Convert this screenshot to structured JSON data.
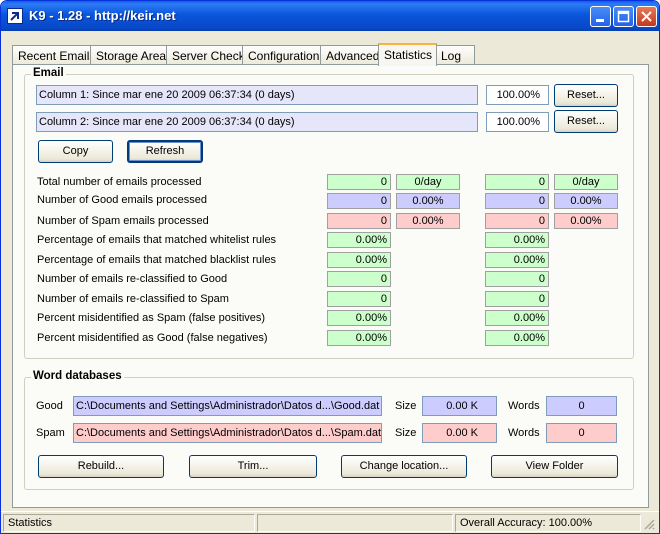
{
  "window": {
    "title": "K9 - 1.28 - http://keir.net"
  },
  "tabs": [
    "Recent Emails",
    "Storage Area",
    "Server Check",
    "Configuration",
    "Advanced",
    "Statistics",
    "Log"
  ],
  "email": {
    "group_title": "Email",
    "column1_text": "Column 1: Since mar ene 20 2009  06:37:34 (0 days)",
    "column1_accuracy": "100.00%",
    "column2_text": "Column 2: Since mar ene 20 2009  06:37:34 (0 days)",
    "column2_accuracy": "100.00%",
    "reset_label": "Reset...",
    "copy_label": "Copy",
    "refresh_label": "Refresh",
    "stats": [
      {
        "label": "Total number of emails processed",
        "c1": "0",
        "c1_rate": "0/day",
        "c2": "0",
        "c2_rate": "0/day",
        "tone": "green"
      },
      {
        "label": "Number of Good emails processed",
        "c1": "0",
        "c1_rate": "0.00%",
        "c2": "0",
        "c2_rate": "0.00%",
        "tone": "blue"
      },
      {
        "label": "Number of Spam emails processed",
        "c1": "0",
        "c1_rate": "0.00%",
        "c2": "0",
        "c2_rate": "0.00%",
        "tone": "red"
      },
      {
        "label": "Percentage of emails that matched whitelist rules",
        "c1": "0.00%",
        "c2": "0.00%",
        "tone": "green"
      },
      {
        "label": "Percentage of emails that matched blacklist rules",
        "c1": "0.00%",
        "c2": "0.00%",
        "tone": "green"
      },
      {
        "label": "Number of emails re-classified to Good",
        "c1": "0",
        "c2": "0",
        "tone": "green"
      },
      {
        "label": "Number of emails re-classified to Spam",
        "c1": "0",
        "c2": "0",
        "tone": "green"
      },
      {
        "label": "Percent misidentified as Spam (false positives)",
        "c1": "0.00%",
        "c2": "0.00%",
        "tone": "green"
      },
      {
        "label": "Percent misidentified as Good (false negatives)",
        "c1": "0.00%",
        "c2": "0.00%",
        "tone": "green"
      }
    ]
  },
  "word_databases": {
    "group_title": "Word databases",
    "good": {
      "label": "Good",
      "path": "C:\\Documents and Settings\\Administrador\\Datos d...\\Good.dat",
      "size_label": "Size",
      "size": "0.00 K",
      "words_label": "Words",
      "words": "0"
    },
    "spam": {
      "label": "Spam",
      "path": "C:\\Documents and Settings\\Administrador\\Datos d...\\Spam.dat",
      "size_label": "Size",
      "size": "0.00 K",
      "words_label": "Words",
      "words": "0"
    },
    "buttons": {
      "rebuild": "Rebuild...",
      "trim": "Trim...",
      "change_location": "Change location...",
      "view_folder": "View Folder"
    }
  },
  "status_bar": {
    "left": "Statistics",
    "middle": "",
    "right": "Overall Accuracy: 100.00%"
  },
  "colors": {
    "green": "#ccffcc",
    "blue": "#ccccff",
    "red": "#ffcccc",
    "light_blue": "#e6e6fa",
    "title_bar": "#0a56dc",
    "active_tab_accent": "#f6b33f"
  },
  "icons": {
    "app": "k9-arrow-icon",
    "minimize": "minimize-icon",
    "maximize": "maximize-icon",
    "close": "close-icon"
  }
}
